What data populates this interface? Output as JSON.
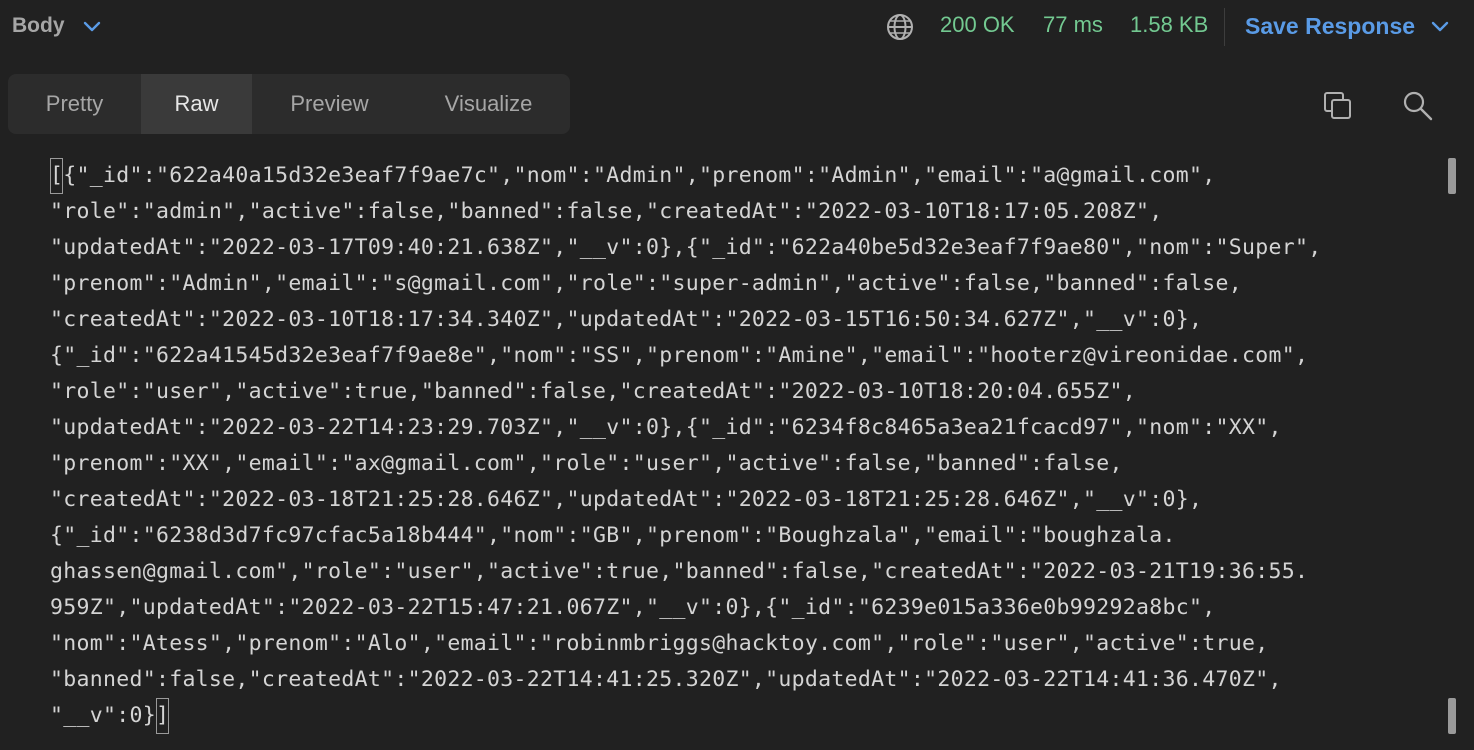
{
  "header": {
    "body_label": "Body",
    "status": "200 OK",
    "time": "77 ms",
    "size": "1.58 KB",
    "save_label": "Save Response"
  },
  "tabs": [
    {
      "label": "Pretty",
      "active": false
    },
    {
      "label": "Raw",
      "active": true
    },
    {
      "label": "Preview",
      "active": false
    },
    {
      "label": "Visualize",
      "active": false
    }
  ],
  "icons": {
    "globe": "globe-icon",
    "copy": "copy-icon",
    "search": "search-icon",
    "chevron": "chevron-down-icon"
  },
  "colors": {
    "background": "#212121",
    "status_green": "#73c991",
    "accent_blue": "#5a9be6"
  },
  "raw": {
    "open_bracket": "[",
    "line_0_rest": "{\"_id\":\"622a40a15d32e3eaf7f9ae7c\",\"nom\":\"Admin\",\"prenom\":\"Admin\",\"email\":\"a@gmail.com\",",
    "lines": [
      "\"role\":\"admin\",\"active\":false,\"banned\":false,\"createdAt\":\"2022-03-10T18:17:05.208Z\",",
      "\"updatedAt\":\"2022-03-17T09:40:21.638Z\",\"__v\":0},{\"_id\":\"622a40be5d32e3eaf7f9ae80\",\"nom\":\"Super\",",
      "\"prenom\":\"Admin\",\"email\":\"s@gmail.com\",\"role\":\"super-admin\",\"active\":false,\"banned\":false,",
      "\"createdAt\":\"2022-03-10T18:17:34.340Z\",\"updatedAt\":\"2022-03-15T16:50:34.627Z\",\"__v\":0},",
      "{\"_id\":\"622a41545d32e3eaf7f9ae8e\",\"nom\":\"SS\",\"prenom\":\"Amine\",\"email\":\"hooterz@vireonidae.com\",",
      "\"role\":\"user\",\"active\":true,\"banned\":false,\"createdAt\":\"2022-03-10T18:20:04.655Z\",",
      "\"updatedAt\":\"2022-03-22T14:23:29.703Z\",\"__v\":0},{\"_id\":\"6234f8c8465a3ea21fcacd97\",\"nom\":\"XX\",",
      "\"prenom\":\"XX\",\"email\":\"ax@gmail.com\",\"role\":\"user\",\"active\":false,\"banned\":false,",
      "\"createdAt\":\"2022-03-18T21:25:28.646Z\",\"updatedAt\":\"2022-03-18T21:25:28.646Z\",\"__v\":0},",
      "{\"_id\":\"6238d3d7fc97cfac5a18b444\",\"nom\":\"GB\",\"prenom\":\"Boughzala\",\"email\":\"boughzala.",
      "ghassen@gmail.com\",\"role\":\"user\",\"active\":true,\"banned\":false,\"createdAt\":\"2022-03-21T19:36:55.",
      "959Z\",\"updatedAt\":\"2022-03-22T15:47:21.067Z\",\"__v\":0},{\"_id\":\"6239e015a336e0b99292a8bc\",",
      "\"nom\":\"Atess\",\"prenom\":\"Alo\",\"email\":\"robinmbriggs@hacktoy.com\",\"role\":\"user\",\"active\":true,",
      "\"banned\":false,\"createdAt\":\"2022-03-22T14:41:25.320Z\",\"updatedAt\":\"2022-03-22T14:41:36.470Z\","
    ],
    "last_line_start": "\"__v\":0}",
    "close_bracket": "]"
  }
}
